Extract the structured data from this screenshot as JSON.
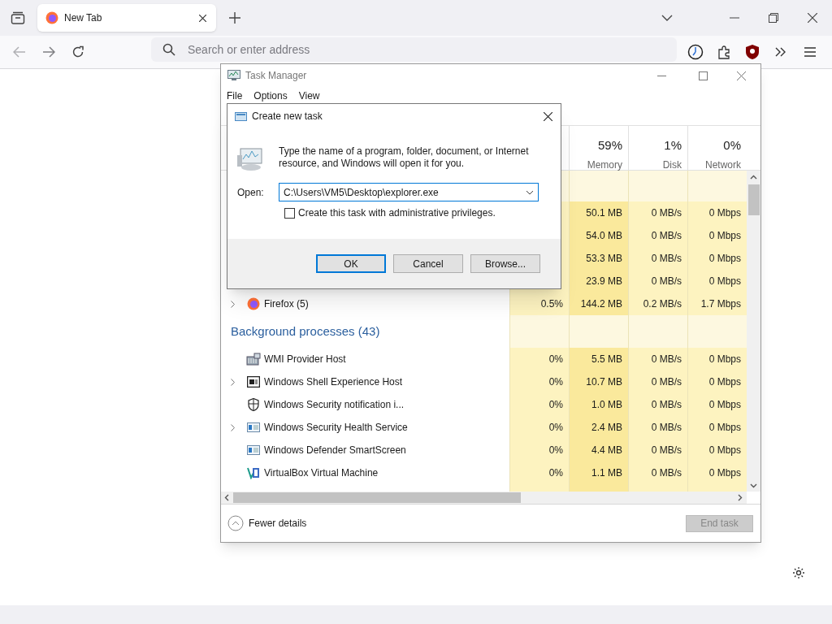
{
  "browser": {
    "tabs": [
      {
        "label": "New Tab",
        "selected": true
      }
    ],
    "address": {
      "placeholder": "Search or enter address"
    }
  },
  "task_manager": {
    "title": "Task Manager",
    "menu": [
      "File",
      "Options",
      "View"
    ],
    "columns": [
      {
        "percent": "59%",
        "label": "Memory"
      },
      {
        "percent": "1%",
        "label": "Disk"
      },
      {
        "percent": "0%",
        "label": "Network"
      }
    ],
    "rows": [
      {
        "kind": "spacer"
      },
      {
        "kind": "process",
        "memory": "50.1 MB",
        "disk": "0 MB/s",
        "network": "0 Mbps"
      },
      {
        "kind": "process",
        "memory": "54.0 MB",
        "disk": "0 MB/s",
        "network": "0 Mbps"
      },
      {
        "kind": "process",
        "memory": "53.3 MB",
        "disk": "0 MB/s",
        "network": "0 Mbps"
      },
      {
        "kind": "process",
        "memory": "23.9 MB",
        "disk": "0 MB/s",
        "network": "0 Mbps"
      },
      {
        "kind": "process",
        "name": "Firefox (5)",
        "expandable": true,
        "cpu": "0.5%",
        "memory": "144.2 MB",
        "disk": "0.2 MB/s",
        "network": "1.7 Mbps"
      },
      {
        "kind": "group",
        "label": "Background processes (43)"
      },
      {
        "kind": "process",
        "name": "WMI Provider Host",
        "expandable": false,
        "cpu": "0%",
        "memory": "5.5 MB",
        "disk": "0 MB/s",
        "network": "0 Mbps"
      },
      {
        "kind": "process",
        "name": "Windows Shell Experience Host",
        "expandable": true,
        "cpu": "0%",
        "memory": "10.7 MB",
        "disk": "0 MB/s",
        "network": "0 Mbps"
      },
      {
        "kind": "process",
        "name": "Windows Security notification i...",
        "expandable": false,
        "cpu": "0%",
        "memory": "1.0 MB",
        "disk": "0 MB/s",
        "network": "0 Mbps"
      },
      {
        "kind": "process",
        "name": "Windows Security Health Service",
        "expandable": true,
        "cpu": "0%",
        "memory": "2.4 MB",
        "disk": "0 MB/s",
        "network": "0 Mbps"
      },
      {
        "kind": "process",
        "name": "Windows Defender SmartScreen",
        "expandable": false,
        "cpu": "0%",
        "memory": "4.4 MB",
        "disk": "0 MB/s",
        "network": "0 Mbps"
      },
      {
        "kind": "process",
        "name": "VirtualBox Virtual Machine",
        "expandable": false,
        "cpu": "0%",
        "memory": "1.1 MB",
        "disk": "0 MB/s",
        "network": "0 Mbps"
      }
    ],
    "footer": {
      "fewer_details": "Fewer details",
      "end_task": {
        "label": "End task",
        "disabled": true
      }
    }
  },
  "dialog": {
    "title": "Create new task",
    "message": "Type the name of a program, folder, document, or Internet resource, and Windows will open it for you.",
    "open_label": "Open:",
    "value": "C:\\Users\\VM5\\Desktop\\explorer.exe",
    "checkbox": {
      "label": "Create this task with administrative privileges.",
      "checked": false
    },
    "buttons": [
      {
        "label": "OK",
        "default": true
      },
      {
        "label": "Cancel",
        "default": false
      },
      {
        "label": "Browse...",
        "default": false
      }
    ]
  }
}
